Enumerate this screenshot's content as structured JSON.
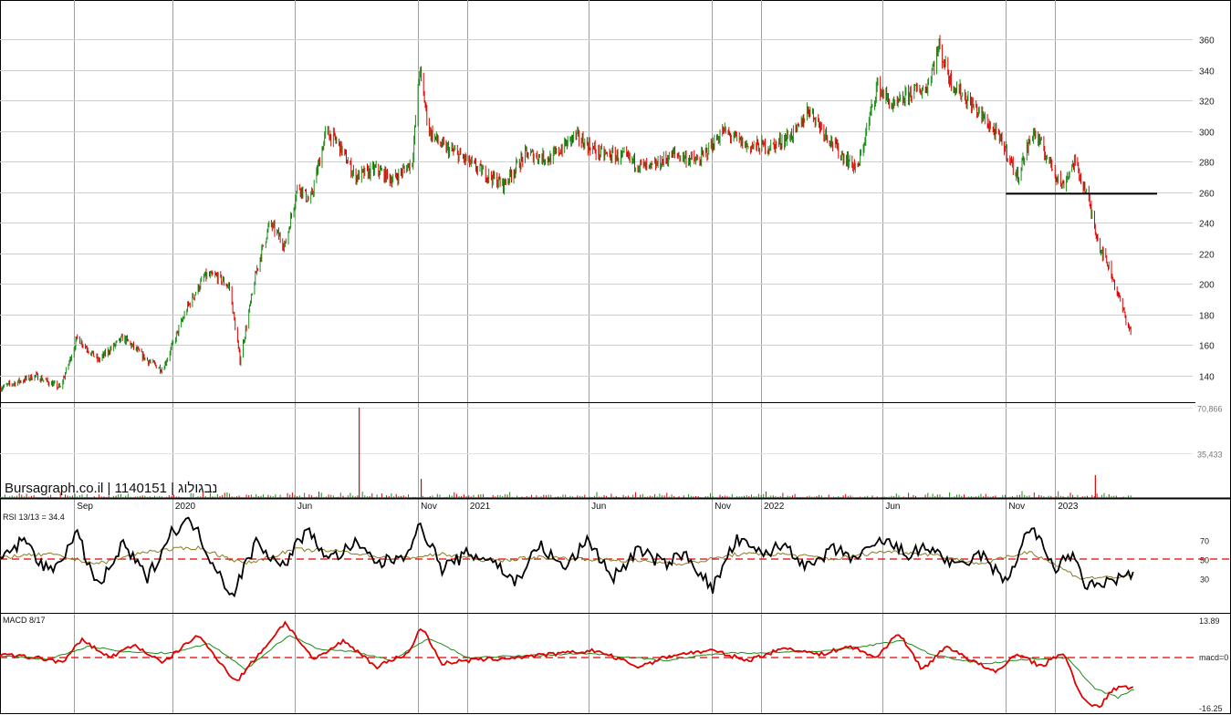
{
  "chart_data": [
    {
      "type": "candlestick",
      "panel": "price",
      "ylim": [
        125,
        370
      ],
      "y_ticks": [
        "140",
        "160",
        "180",
        "200",
        "220",
        "240",
        "260",
        "280",
        "300",
        "320",
        "340",
        "360"
      ],
      "y_tick_values": [
        140,
        160,
        180,
        200,
        220,
        240,
        260,
        280,
        300,
        320,
        340,
        360
      ],
      "x_tick_labels": [
        "Sep",
        "2020",
        "Jun",
        "Nov",
        "2021",
        "Jun",
        "Nov",
        "2022",
        "Jun",
        "Nov",
        "2023"
      ],
      "x_tick_dates": [
        "2019-09-01",
        "2020-01-01",
        "2020-06-01",
        "2020-11-01",
        "2021-01-01",
        "2021-06-01",
        "2021-11-01",
        "2022-01-01",
        "2022-06-01",
        "2022-11-01",
        "2023-01-01"
      ],
      "x_start": "2019-06-01",
      "x_end": "2023-04-15",
      "support_line": {
        "value": 259,
        "from": "2022-11-01",
        "to": "2023-05-01",
        "color": "#000000"
      },
      "close_series": {
        "x": [
          "2019-06-01",
          "2019-07-15",
          "2019-08-15",
          "2019-09-05",
          "2019-10-01",
          "2019-11-01",
          "2019-12-01",
          "2019-12-20",
          "2020-01-20",
          "2020-02-10",
          "2020-02-25",
          "2020-03-12",
          "2020-03-25",
          "2020-04-15",
          "2020-05-01",
          "2020-05-20",
          "2020-06-05",
          "2020-06-20",
          "2020-07-10",
          "2020-07-25",
          "2020-08-15",
          "2020-09-10",
          "2020-10-01",
          "2020-10-25",
          "2020-11-03",
          "2020-11-15",
          "2020-12-01",
          "2020-12-20",
          "2021-01-15",
          "2021-02-15",
          "2021-03-15",
          "2021-04-15",
          "2021-05-15",
          "2021-06-15",
          "2021-07-15",
          "2021-08-15",
          "2021-09-15",
          "2021-10-15",
          "2021-11-15",
          "2021-12-15",
          "2022-01-15",
          "2022-02-15",
          "2022-03-01",
          "2022-03-20",
          "2022-04-10",
          "2022-05-01",
          "2022-05-25",
          "2022-06-15",
          "2022-07-05",
          "2022-07-25",
          "2022-08-10",
          "2022-08-25",
          "2022-09-15",
          "2022-10-10",
          "2022-10-30",
          "2022-11-15",
          "2022-12-05",
          "2022-12-25",
          "2023-01-10",
          "2023-01-25",
          "2023-02-10",
          "2023-02-25",
          "2023-03-10",
          "2023-03-25",
          "2023-04-05"
        ],
        "y": [
          132,
          140,
          132,
          165,
          150,
          165,
          150,
          144,
          185,
          205,
          205,
          198,
          150,
          210,
          240,
          225,
          265,
          253,
          300,
          292,
          270,
          275,
          268,
          280,
          340,
          300,
          290,
          285,
          275,
          265,
          285,
          282,
          297,
          285,
          283,
          275,
          285,
          280,
          300,
          290,
          290,
          300,
          315,
          300,
          285,
          275,
          330,
          315,
          325,
          328,
          355,
          332,
          320,
          305,
          290,
          270,
          300,
          280,
          264,
          280,
          258,
          225,
          210,
          185,
          168
        ]
      },
      "wick_scale_note": "candle colors",
      "colors": {
        "up": "#1a8c1a",
        "down": "#e00000"
      }
    },
    {
      "type": "bar",
      "panel": "volume",
      "ylim": [
        0,
        70866
      ],
      "y_ticks": [
        "35,433",
        "70,866"
      ],
      "y_tick_values": [
        35433,
        70866
      ],
      "spikes": [
        {
          "x": "2020-08-20",
          "value": 70866
        },
        {
          "x": "2020-11-05",
          "value": 15000
        },
        {
          "x": "2023-02-20",
          "value": 18000
        }
      ],
      "colors": {
        "up": "#1a8c1a",
        "down": "#e00000"
      }
    },
    {
      "type": "line",
      "panel": "rsi",
      "title": "RSI 13/13 = 34.4",
      "current_value": 34.4,
      "ylim": [
        0,
        100
      ],
      "y_ticks": [
        "30",
        "50",
        "70"
      ],
      "y_tick_values": [
        30,
        50,
        70
      ],
      "reference_line": {
        "value": 50,
        "color": "#e00000",
        "style": "dashed"
      },
      "series": [
        {
          "color": "#000000",
          "x": [
            "2019-06-01",
            "2019-07-01",
            "2019-08-01",
            "2019-09-05",
            "2019-10-01",
            "2019-11-01",
            "2019-12-01",
            "2020-01-01",
            "2020-01-25",
            "2020-02-15",
            "2020-03-15",
            "2020-04-15",
            "2020-05-15",
            "2020-06-15",
            "2020-07-15",
            "2020-08-15",
            "2020-09-15",
            "2020-10-15",
            "2020-11-05",
            "2020-12-01",
            "2021-01-01",
            "2021-02-01",
            "2021-03-01",
            "2021-04-01",
            "2021-05-01",
            "2021-06-01",
            "2021-07-01",
            "2021-08-01",
            "2021-09-01",
            "2021-10-01",
            "2021-11-01",
            "2021-12-01",
            "2022-01-01",
            "2022-02-01",
            "2022-03-01",
            "2022-04-01",
            "2022-05-01",
            "2022-06-01",
            "2022-07-01",
            "2022-08-01",
            "2022-09-01",
            "2022-10-01",
            "2022-11-01",
            "2022-12-01",
            "2023-01-01",
            "2023-01-20",
            "2023-02-10",
            "2023-03-01",
            "2023-03-20",
            "2023-04-10"
          ],
          "y": [
            50,
            70,
            35,
            75,
            20,
            65,
            30,
            80,
            90,
            55,
            12,
            70,
            40,
            80,
            50,
            65,
            45,
            55,
            85,
            40,
            55,
            50,
            25,
            65,
            40,
            70,
            30,
            60,
            45,
            55,
            18,
            70,
            55,
            65,
            40,
            60,
            50,
            70,
            55,
            62,
            40,
            55,
            25,
            85,
            40,
            55,
            20,
            25,
            30,
            34.4
          ]
        },
        {
          "color": "#8a7a20",
          "x": [
            "2019-06-01",
            "2019-08-01",
            "2019-10-01",
            "2019-12-01",
            "2020-02-01",
            "2020-04-01",
            "2020-06-01",
            "2020-08-01",
            "2020-10-01",
            "2020-12-01",
            "2021-02-01",
            "2021-04-01",
            "2021-06-01",
            "2021-08-01",
            "2021-10-01",
            "2021-12-01",
            "2022-02-01",
            "2022-04-01",
            "2022-06-01",
            "2022-08-01",
            "2022-10-01",
            "2022-12-01",
            "2023-02-01",
            "2023-04-10"
          ],
          "y": [
            52,
            55,
            45,
            58,
            62,
            45,
            60,
            58,
            50,
            55,
            48,
            52,
            50,
            48,
            45,
            55,
            55,
            50,
            58,
            55,
            45,
            58,
            30,
            32
          ]
        }
      ]
    },
    {
      "type": "line",
      "panel": "macd",
      "title": "MACD 8/17",
      "ylim": [
        -16.25,
        13.89
      ],
      "y_ticks": [
        "13.89",
        "macd=0",
        "-16.25"
      ],
      "y_tick_values": [
        13.89,
        0,
        -16.25
      ],
      "reference_line": {
        "value": 0,
        "color": "#e00000",
        "style": "dashed"
      },
      "series": [
        {
          "color": "#e00000",
          "x": [
            "2019-06-01",
            "2019-07-15",
            "2019-08-20",
            "2019-09-10",
            "2019-10-15",
            "2019-11-15",
            "2019-12-20",
            "2020-02-01",
            "2020-03-20",
            "2020-04-20",
            "2020-05-20",
            "2020-06-25",
            "2020-08-01",
            "2020-09-10",
            "2020-10-20",
            "2020-11-05",
            "2020-12-01",
            "2021-01-01",
            "2021-03-01",
            "2021-05-01",
            "2021-06-10",
            "2021-08-01",
            "2021-09-15",
            "2021-11-01",
            "2021-12-15",
            "2022-02-01",
            "2022-03-15",
            "2022-04-20",
            "2022-05-25",
            "2022-06-20",
            "2022-07-20",
            "2022-08-20",
            "2022-09-20",
            "2022-10-20",
            "2022-11-15",
            "2022-12-15",
            "2023-01-10",
            "2023-02-05",
            "2023-02-25",
            "2023-03-15",
            "2023-04-10"
          ],
          "y": [
            1,
            0,
            -1.5,
            6.5,
            0,
            4.5,
            -2,
            8,
            -8,
            2,
            12.5,
            -1,
            6,
            -3,
            1.5,
            11,
            -2,
            -1,
            0,
            1.5,
            2.5,
            -3,
            1,
            2.5,
            -1,
            3.5,
            1,
            4,
            0,
            9,
            -4,
            4,
            -1,
            -5,
            1.5,
            -3,
            2,
            -14,
            -16,
            -10,
            -9.5
          ]
        },
        {
          "color": "#1a8c1a",
          "x": [
            "2019-06-01",
            "2019-08-01",
            "2019-09-20",
            "2019-11-01",
            "2020-01-01",
            "2020-02-15",
            "2020-04-01",
            "2020-05-25",
            "2020-07-01",
            "2020-08-15",
            "2020-10-01",
            "2020-11-15",
            "2021-01-01",
            "2021-03-01",
            "2021-06-01",
            "2021-09-01",
            "2021-11-15",
            "2022-02-01",
            "2022-04-01",
            "2022-06-25",
            "2022-08-01",
            "2022-10-01",
            "2022-12-01",
            "2023-01-15",
            "2023-02-20",
            "2023-03-20",
            "2023-04-10"
          ],
          "y": [
            0.5,
            -0.5,
            4,
            2,
            1.5,
            5,
            -4,
            8,
            3,
            2,
            -1,
            7,
            0,
            0.5,
            1.5,
            -1,
            1.5,
            2,
            2.5,
            6,
            1,
            -2,
            -0.5,
            0,
            -10,
            -13,
            -10
          ]
        }
      ]
    }
  ],
  "watermark": {
    "text": "Bursagraph.co.il | 1140151 | נבגולוג"
  },
  "rsi_label": "RSI 13/13 = 34.4",
  "macd_label": "MACD 8/17"
}
